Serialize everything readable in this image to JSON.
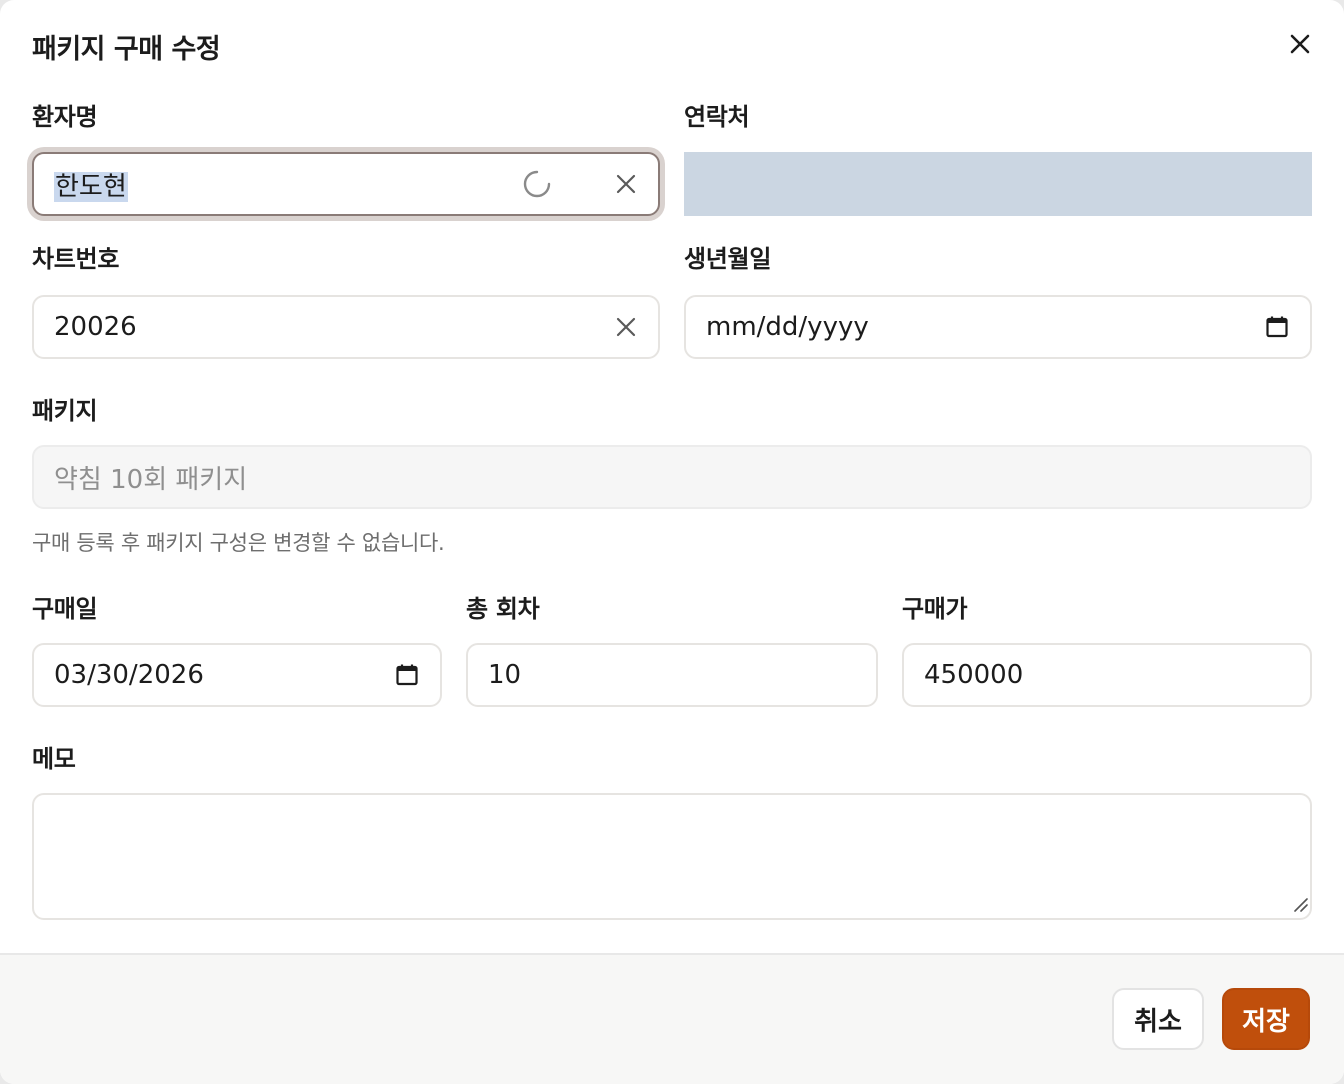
{
  "dialog": {
    "title": "패키지 구매 수정",
    "close_icon": "close-icon"
  },
  "patient_name": {
    "label": "환자명",
    "value": "한도현",
    "icons": [
      "loading-spinner-icon",
      "clear-icon"
    ]
  },
  "contact": {
    "label": "연락처",
    "value": ""
  },
  "chart_number": {
    "label": "차트번호",
    "value": "20026",
    "icons": [
      "clear-icon"
    ]
  },
  "birthdate": {
    "label": "생년월일",
    "placeholder": "mm/dd/yyyy",
    "icons": [
      "calendar-icon"
    ]
  },
  "package": {
    "label": "패키지",
    "value": "약침 10회 패키지",
    "hint": "구매 등록 후 패키지 구성은 변경할 수 없습니다."
  },
  "purchase_date": {
    "label": "구매일",
    "value": "03/30/2026",
    "icons": [
      "calendar-icon"
    ]
  },
  "total_sessions": {
    "label": "총 회차",
    "value": "10"
  },
  "price": {
    "label": "구매가",
    "value": "450000"
  },
  "memo": {
    "label": "메모",
    "value": ""
  },
  "footer": {
    "cancel_label": "취소",
    "save_label": "저장"
  },
  "colors": {
    "accent": "#c04f0c",
    "selection": "#c9d8ee",
    "autofill": "#cbd6e2"
  }
}
